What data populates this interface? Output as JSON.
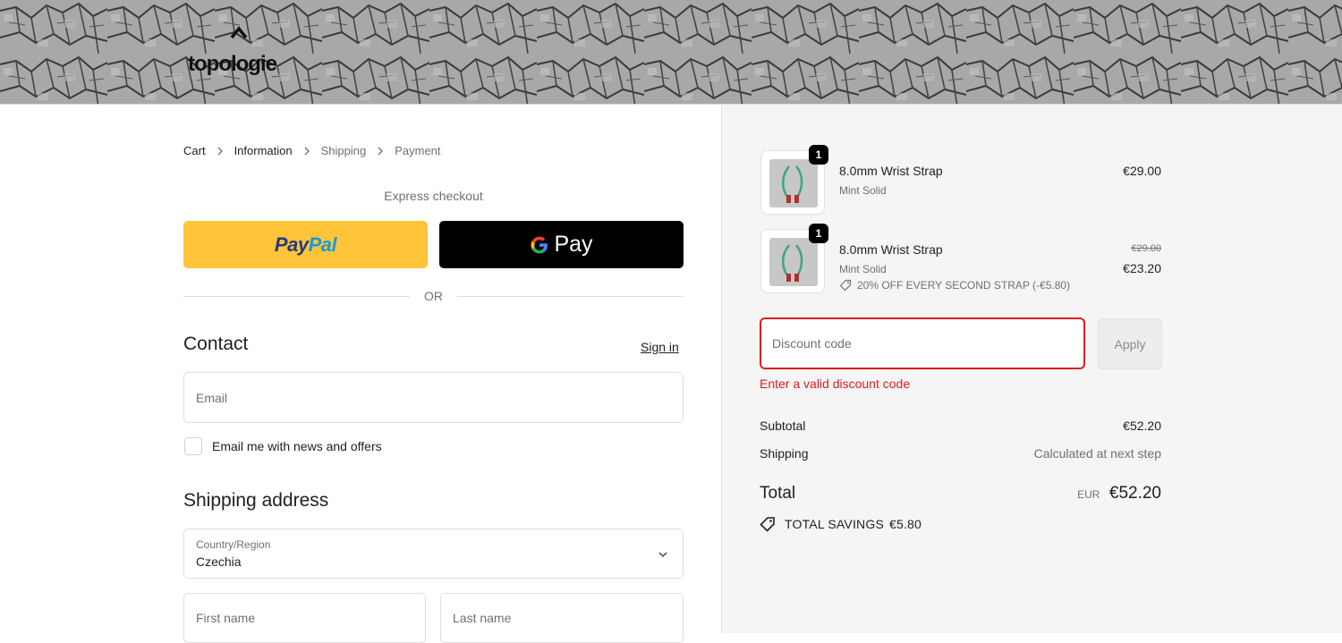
{
  "brand": {
    "name": "topologie"
  },
  "breadcrumb": [
    {
      "label": "Cart"
    },
    {
      "label": "Information"
    },
    {
      "label": "Shipping"
    },
    {
      "label": "Payment"
    }
  ],
  "express": {
    "title": "Express checkout",
    "paypal_label_a": "Pay",
    "paypal_label_b": "Pal",
    "gpay_label": "Pay",
    "or_label": "OR"
  },
  "contact": {
    "heading": "Contact",
    "signin_label": "Sign in",
    "email_placeholder": "Email",
    "newsletter_label": "Email me with news and offers"
  },
  "shipping_address": {
    "heading": "Shipping address",
    "country_label": "Country/Region",
    "country_value": "Czechia",
    "first_name_placeholder": "First name",
    "last_name_placeholder": "Last name"
  },
  "summary": {
    "items": [
      {
        "qty": "1",
        "name": "8.0mm Wrist Strap",
        "variant": "Mint Solid",
        "price": "€29.00"
      },
      {
        "qty": "1",
        "name": "8.0mm Wrist Strap",
        "variant": "Mint Solid",
        "old_price": "€29.00",
        "price": "€23.20",
        "discount": "20% OFF EVERY SECOND STRAP (-€5.80)"
      }
    ],
    "discount_placeholder": "Discount code",
    "apply_label": "Apply",
    "discount_error": "Enter a valid discount code",
    "subtotal_label": "Subtotal",
    "subtotal_value": "€52.20",
    "shipping_label": "Shipping",
    "shipping_value": "Calculated at next step",
    "total_label": "Total",
    "total_currency": "EUR",
    "total_value": "€52.20",
    "savings_label": "TOTAL SAVINGS",
    "savings_value": "€5.80"
  },
  "colors": {
    "paypal_yellow": "#ffc439",
    "error_red": "#dd1d1d",
    "summary_bg": "#f5f5f5"
  }
}
